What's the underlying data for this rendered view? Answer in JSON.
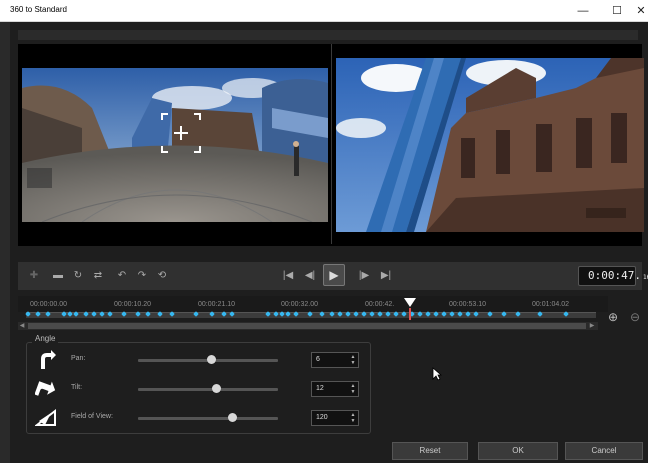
{
  "window": {
    "title": "360 to Standard",
    "controls": [
      "—",
      "☐",
      "✕"
    ]
  },
  "playback": {
    "timecode_main": "0:00:47.",
    "timecode_frac": "16"
  },
  "timeline": {
    "ticks": [
      "00:00:00.00",
      "00:00:10.20",
      "00:00:21.10",
      "00:00:32.00",
      "00:00:42.",
      "00:00:53.10",
      "00:01:04.02"
    ]
  },
  "angle": {
    "group_label": "Angle",
    "pan": {
      "label": "Pan:",
      "value": "6",
      "level": 0.52
    },
    "tilt": {
      "label": "Tilt:",
      "value": "12",
      "level": 0.56
    },
    "fov": {
      "label": "Field of View:",
      "value": "120",
      "level": 0.67
    }
  },
  "buttons": {
    "reset": "Reset",
    "ok": "OK",
    "cancel": "Cancel"
  },
  "colors": {
    "keyframe": "#36b8f0",
    "playhead": "#e05050"
  }
}
